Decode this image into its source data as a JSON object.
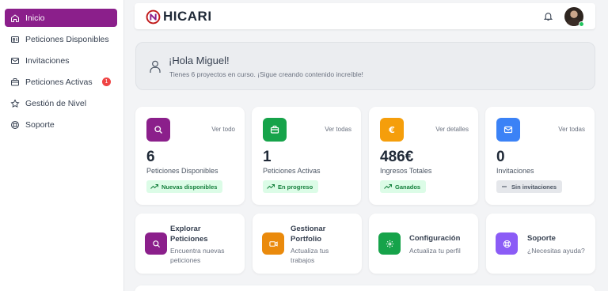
{
  "sidebar": {
    "items": [
      {
        "label": "Inicio",
        "icon": "home-icon",
        "active": true
      },
      {
        "label": "Peticiones Disponibles",
        "icon": "id-card-icon"
      },
      {
        "label": "Invitaciones",
        "icon": "mail-icon"
      },
      {
        "label": "Peticiones Activas",
        "icon": "briefcase-icon",
        "badge": "1"
      },
      {
        "label": "Gestión de Nivel",
        "icon": "star-icon"
      },
      {
        "label": "Soporte",
        "icon": "lifebuoy-icon"
      }
    ]
  },
  "header": {
    "logo_text": "HICARI"
  },
  "welcome": {
    "title": "¡Hola Miguel!",
    "subtitle": "Tienes 6 proyectos en curso. ¡Sigue creando contenido increíble!"
  },
  "stats": [
    {
      "icon": "search-icon",
      "color": "#8b1f8b",
      "link": "Ver todo",
      "value": "6",
      "label": "Peticiones Disponibles",
      "tag": "Nuevas disponibles",
      "tag_style": "green"
    },
    {
      "icon": "briefcase-icon",
      "color": "#16a34a",
      "link": "Ver todas",
      "value": "1",
      "label": "Peticiones Activas",
      "tag": "En progreso",
      "tag_style": "green"
    },
    {
      "icon": "euro-icon",
      "color": "#f59e0b",
      "link": "Ver detalles",
      "value": "486€",
      "label": "Ingresos Totales",
      "tag": "Ganados",
      "tag_style": "green"
    },
    {
      "icon": "mail-icon",
      "color": "#3b82f6",
      "link": "Ver todas",
      "value": "0",
      "label": "Invitaciones",
      "tag": "Sin invitaciones",
      "tag_style": "gray"
    }
  ],
  "actions": [
    {
      "icon": "search-icon",
      "color": "#8b1f8b",
      "title_1": "Explorar",
      "title_2": "Peticiones",
      "sub_1": "Encuentra nuevas",
      "sub_2": "peticiones"
    },
    {
      "icon": "video-icon",
      "color": "#ea8a0c",
      "title_1": "Gestionar",
      "title_2": "Portfolio",
      "sub_1": "Actualiza tus",
      "sub_2": "trabajos"
    },
    {
      "icon": "gear-icon",
      "color": "#16a34a",
      "title_1": "Configuración",
      "sub_1": "Actualiza tu perfil"
    },
    {
      "icon": "lifebuoy-icon",
      "color": "#8b5cf6",
      "title_1": "Soporte",
      "sub_1": "¿Necesitas ayuda?"
    }
  ]
}
